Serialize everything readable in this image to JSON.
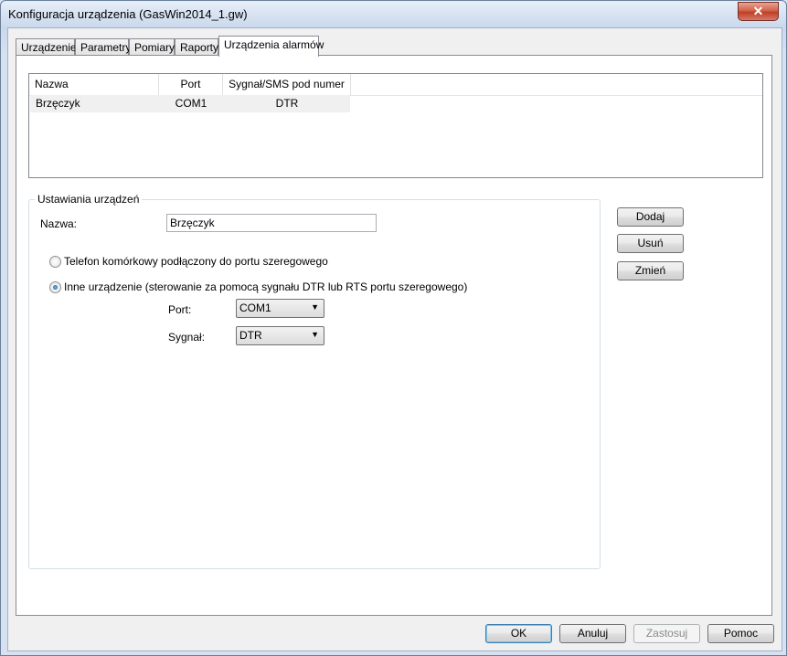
{
  "window": {
    "title": "Konfiguracja urządzenia (GasWin2014_1.gw)",
    "close_glyph": "✕"
  },
  "tabs": [
    {
      "label": "Urządzenie"
    },
    {
      "label": "Parametry"
    },
    {
      "label": "Pomiary"
    },
    {
      "label": "Raporty"
    },
    {
      "label": "Urządzenia alarmów"
    }
  ],
  "list": {
    "columns": [
      "Nazwa",
      "Port",
      "Sygnał/SMS pod numer"
    ],
    "rows": [
      {
        "name": "Brzęczyk",
        "port": "COM1",
        "signal": "DTR"
      }
    ]
  },
  "group": {
    "title": "Ustawiania urządzeń",
    "name_label": "Nazwa:",
    "name_value": "Brzęczyk",
    "radio_phone": "Telefon komórkowy podłączony do portu szeregowego",
    "radio_other": "Inne urządzenie (sterowanie za pomocą sygnału DTR lub RTS portu szeregowego)",
    "port_label": "Port:",
    "port_value": "COM1",
    "signal_label": "Sygnał:",
    "signal_value": "DTR",
    "selected_radio": "other"
  },
  "side_buttons": {
    "add": "Dodaj",
    "remove": "Usuń",
    "change": "Zmień"
  },
  "footer": {
    "ok": "OK",
    "cancel": "Anuluj",
    "apply": "Zastosuj",
    "help": "Pomoc"
  }
}
